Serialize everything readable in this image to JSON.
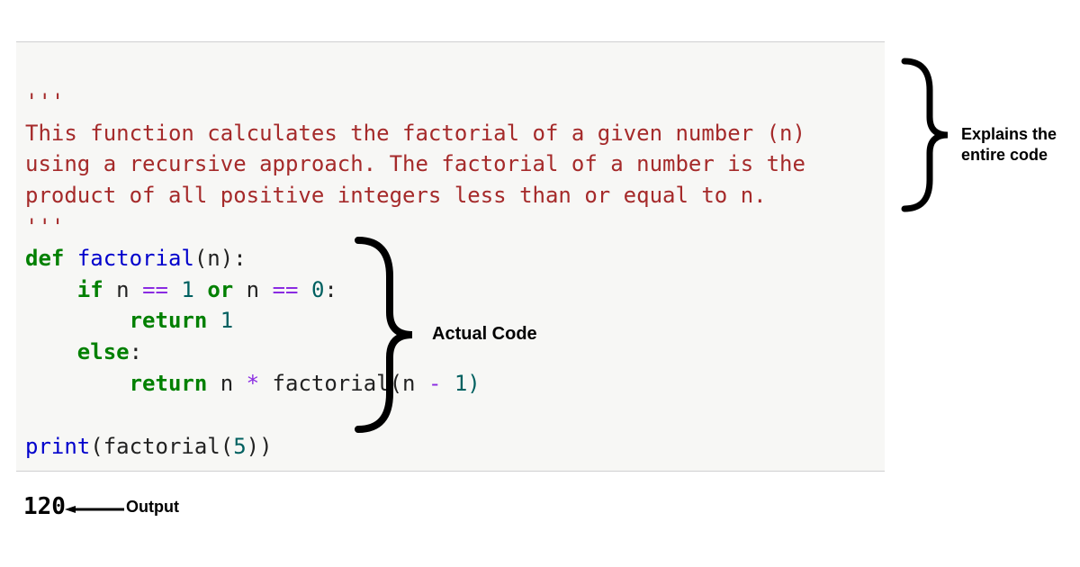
{
  "code": {
    "triple_open": "'''",
    "doc_line1": "This function calculates the factorial of a given number (n)",
    "doc_line2": "using a recursive approach. The factorial of a number is the",
    "doc_line3": "product of all positive integers less than or equal to n.",
    "triple_close": "'''",
    "def_kw": "def",
    "fn_name": "factorial",
    "param_open": "(n)",
    "colon": ":",
    "if_kw": "if",
    "cond_n1": " n ",
    "eq1": "==",
    "one": " 1 ",
    "or_kw": "or",
    "cond_n2": " n ",
    "eq2": "==",
    "zero": " 0",
    "return_kw": "return",
    "ret1_val": " 1",
    "else_kw": "else",
    "ret2_expr_n": " n ",
    "star": "*",
    "call_fact": " factorial(n ",
    "minus": "-",
    "one_close": " 1)",
    "print_call_a": "print",
    "print_call_b": "(factorial(",
    "five": "5",
    "print_call_c": "))"
  },
  "output": "120",
  "annotations": {
    "explains": "Explains the entire code",
    "actual_code": "Actual Code",
    "output_label": "Output"
  }
}
